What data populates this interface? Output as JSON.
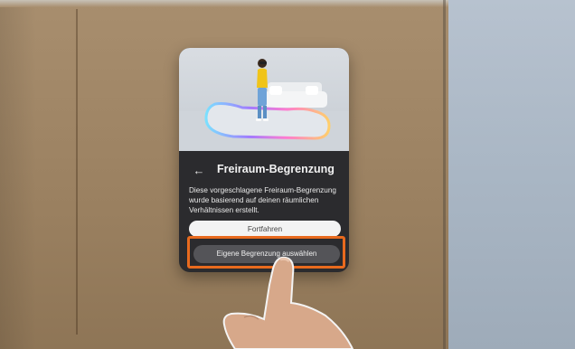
{
  "dialog": {
    "title": "Freiraum-Begrenzung",
    "description": "Diese vorgeschlagene Freiraum-Begrenzung wurde basierend auf deinen räumlichen Verhältnissen erstellt.",
    "back_icon": "arrow-left-icon",
    "primary_button_label": "Fortfahren",
    "secondary_button_label": "Eigene Begrenzung auswählen"
  },
  "colors": {
    "panel_bg": "#2b2b2e",
    "highlight": "#e86a1e",
    "primary_button_bg": "#f3f3f3",
    "secondary_button_bg": "#545458"
  }
}
